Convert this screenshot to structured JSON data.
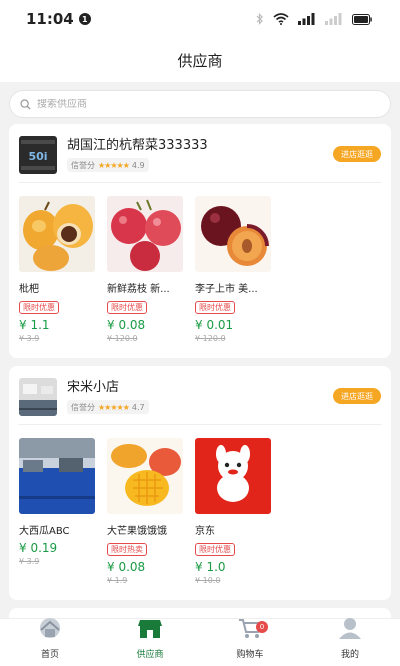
{
  "status_bar": {
    "time": "11:04",
    "notif_count": "1"
  },
  "nav": {
    "title": "供应商"
  },
  "search": {
    "placeholder": "搜索供应商"
  },
  "suppliers": [
    {
      "name": "胡国江的杭帮菜333333",
      "credit_label": "信誉分",
      "stars": "★★★★★",
      "score": "4.9",
      "visit_label": "进店逛逛",
      "products": [
        {
          "name": "枇杷",
          "tag": "限时优惠",
          "price": "¥ 1.1",
          "orig_price": "¥ 3.9"
        },
        {
          "name": "新鲜荔枝 新...",
          "tag": "限时优惠",
          "price": "¥ 0.08",
          "orig_price": "¥ 120.0"
        },
        {
          "name": "李子上市 美...",
          "tag": "限时优惠",
          "price": "¥ 0.01",
          "orig_price": "¥ 120.0"
        }
      ]
    },
    {
      "name": "宋米小店",
      "credit_label": "信誉分",
      "stars": "★★★★★",
      "score": "4.7",
      "visit_label": "进店逛逛",
      "products": [
        {
          "name": "大西瓜ABC",
          "tag": "",
          "price": "¥ 0.19",
          "orig_price": "¥ 3.9"
        },
        {
          "name": "大芒果饿饿饿",
          "tag": "限时热卖",
          "price": "¥ 0.08",
          "orig_price": "¥ 1.9"
        },
        {
          "name": "京东",
          "tag": "限时优惠",
          "price": "¥ 1.0",
          "orig_price": "¥ 10.0"
        }
      ]
    }
  ],
  "tabs": [
    {
      "label": "首页",
      "icon": "home-icon"
    },
    {
      "label": "供应商",
      "icon": "store-icon",
      "active": true
    },
    {
      "label": "购物车",
      "icon": "cart-icon",
      "badge": "0"
    },
    {
      "label": "我的",
      "icon": "user-icon"
    }
  ],
  "colors": {
    "accent_green": "#1a9b45",
    "visit_orange": "#f5a623",
    "tag_red": "#e64b4b"
  }
}
